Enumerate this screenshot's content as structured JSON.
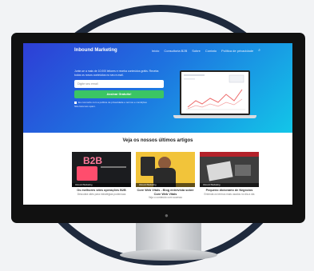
{
  "nav": {
    "brand": "Inbound Marketing",
    "links": [
      "Início",
      "Consultoria B2B",
      "Sobre",
      "Contato",
      "Política de privacidade"
    ]
  },
  "hero": {
    "text": "Junte-se a mais de 10.000 leitores e receba conteúdos grátis. Receba todos os novos conteúdos no seu e-mail.",
    "email_placeholder": "Digite seu email",
    "cta": "Assinar Gratuito!",
    "consent": "Eu concordo com a política de privacidade e termos e condições",
    "protected": "Não fazemos spam."
  },
  "section": {
    "title": "Veja os nossos últimos artigos"
  },
  "cards": [
    {
      "tag": "B2B",
      "bar": "Inbound Marketing",
      "title": "Os melhores sites operações B2B",
      "subtitle": "Descubra sites para estratégias poderosas"
    },
    {
      "tag": "",
      "bar": "Inbound Marketing",
      "title": "Core Web Vitals - Blog entrevista sobre Core Web Vitals",
      "subtitle": "Veja o conteúdo com sucesso"
    },
    {
      "tag": "",
      "bar": "Inbound Marketing",
      "title": "Pequeno dicionário de Negócios",
      "subtitle": "Entenda os termos mais usados no dia a dia"
    }
  ],
  "colors": {
    "brand_blue": "#2e3ed6",
    "cta_green": "#3bc564",
    "cyan": "#13c6e8"
  }
}
